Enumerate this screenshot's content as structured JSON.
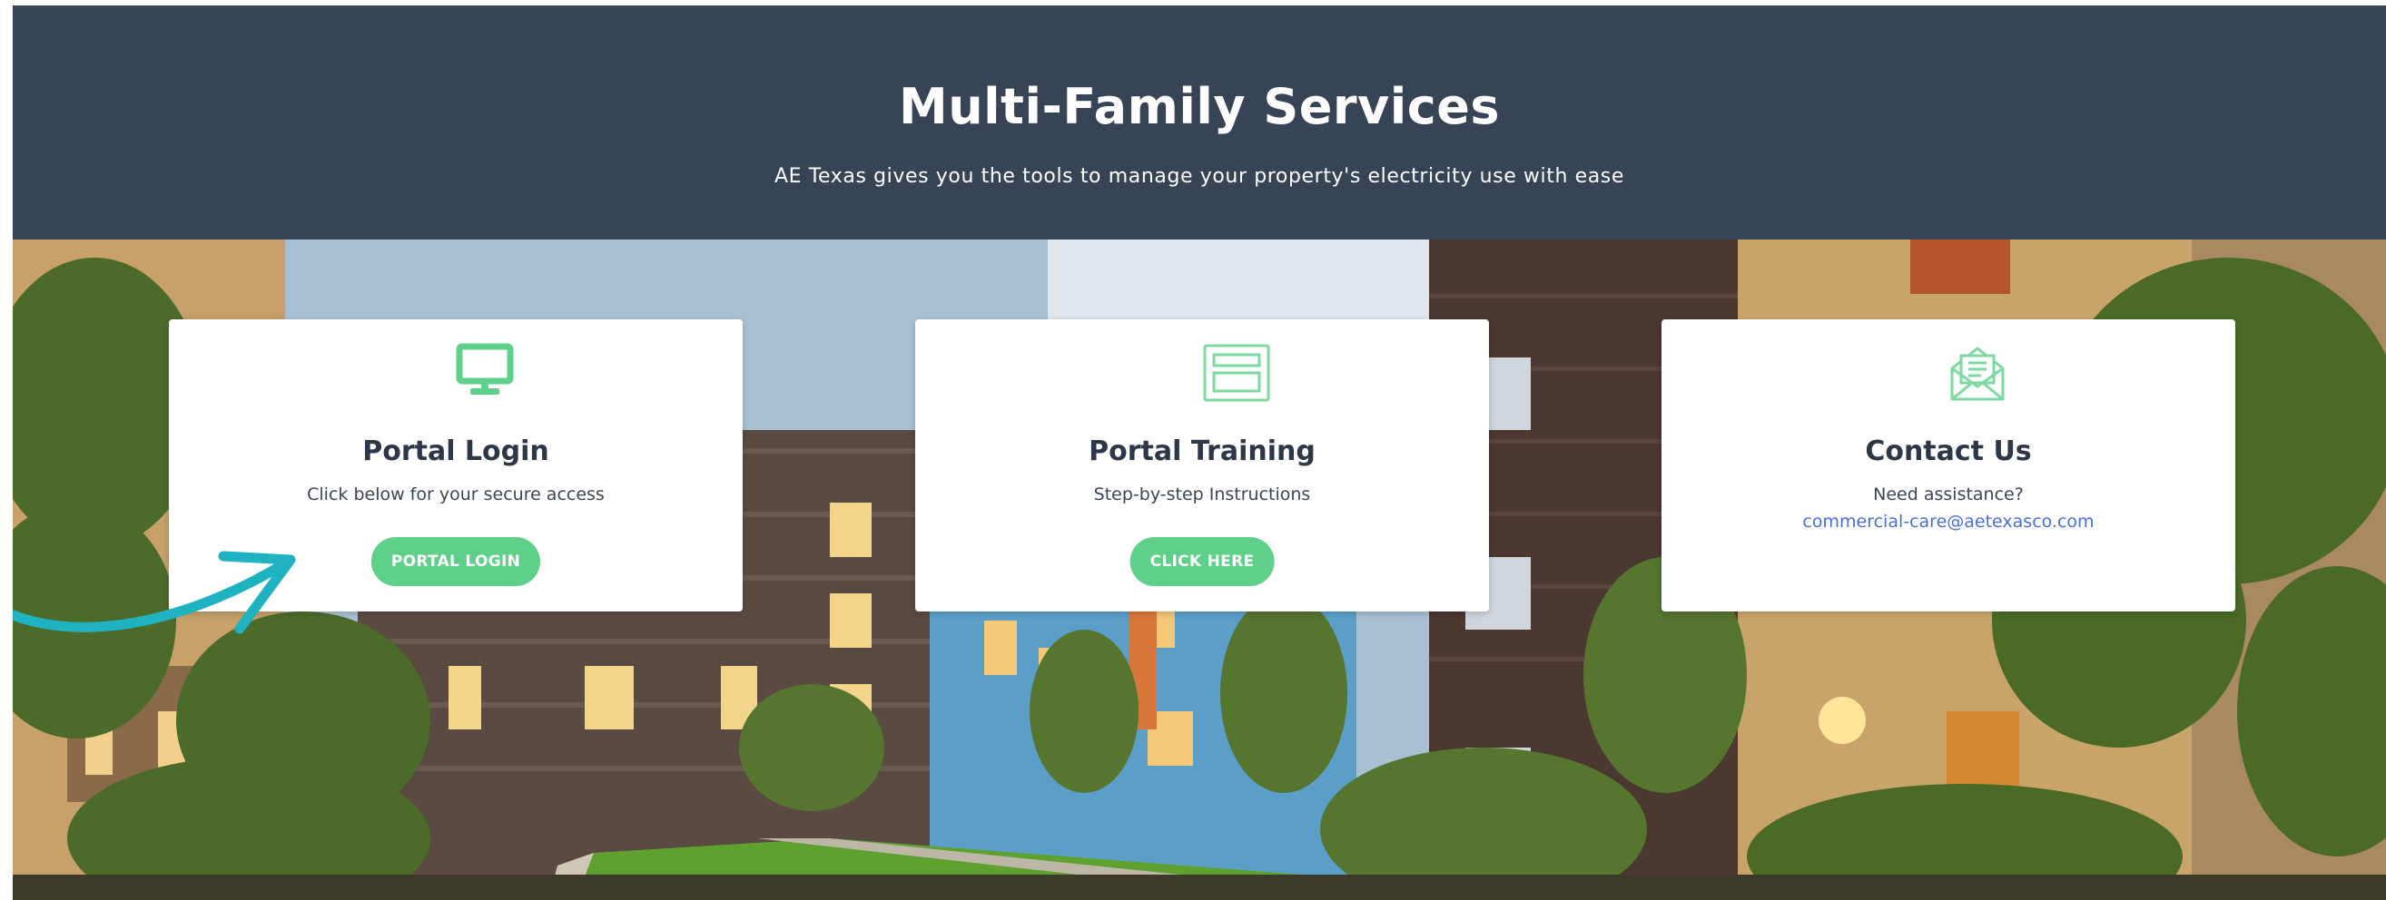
{
  "header": {
    "title": "Multi-Family Services",
    "subtitle": "AE Texas gives you the tools to manage your property's electricity use with ease"
  },
  "cards": [
    {
      "icon": "monitor-icon",
      "title": "Portal Login",
      "description": "Click below for your secure access",
      "button_label": "PORTAL LOGIN"
    },
    {
      "icon": "browser-window-icon",
      "title": "Portal Training",
      "description": "Step-by-step Instructions",
      "button_label": "CLICK HERE"
    },
    {
      "icon": "envelope-letter-icon",
      "title": "Contact Us",
      "description": "Need assistance?",
      "email": "commercial-care@aetexasco.com"
    }
  ],
  "annotation": {
    "icon": "curved-arrow-icon",
    "color": "#1fb3c2"
  },
  "colors": {
    "header_bg": "#374455",
    "accent_green": "#5fd08a",
    "link_blue": "#4a6fd6"
  }
}
